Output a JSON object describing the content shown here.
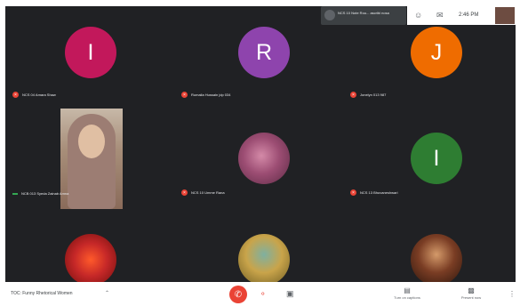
{
  "notification": {
    "text": "NCS 10 Note Rou... ascribi nosa"
  },
  "topbar": {
    "time": "2:46 PM"
  },
  "participants": [
    {
      "initial": "I",
      "color": "#c2185b",
      "name": "NCS 04 Amara Shaw"
    },
    {
      "initial": "R",
      "color": "#8e44ad",
      "name": "Rumaila Hussain jdp 034"
    },
    {
      "initial": "J",
      "color": "#ef6c00",
      "name": "Jonelyn 013 987"
    },
    {
      "initial": "",
      "color": "",
      "name": "NCB 013 Syeda Zainab Amna"
    },
    {
      "initial": "",
      "color": "#7b3f5e",
      "name": "NCS 10 Umme Rana"
    },
    {
      "initial": "I",
      "color": "#2e7d32",
      "name": "NCS 13 Bhuvaneshwari"
    },
    {
      "initial": "",
      "color": "#b71c1c",
      "name": ""
    },
    {
      "initial": "",
      "color": "#a08a3a",
      "name": ""
    },
    {
      "initial": "",
      "color": "#4e2a1e",
      "name": ""
    }
  ],
  "bottombar": {
    "meeting_name": "TOC: Funny Rhetorical Women",
    "captions_label": "Turn on captions",
    "present_label": "Present now"
  }
}
